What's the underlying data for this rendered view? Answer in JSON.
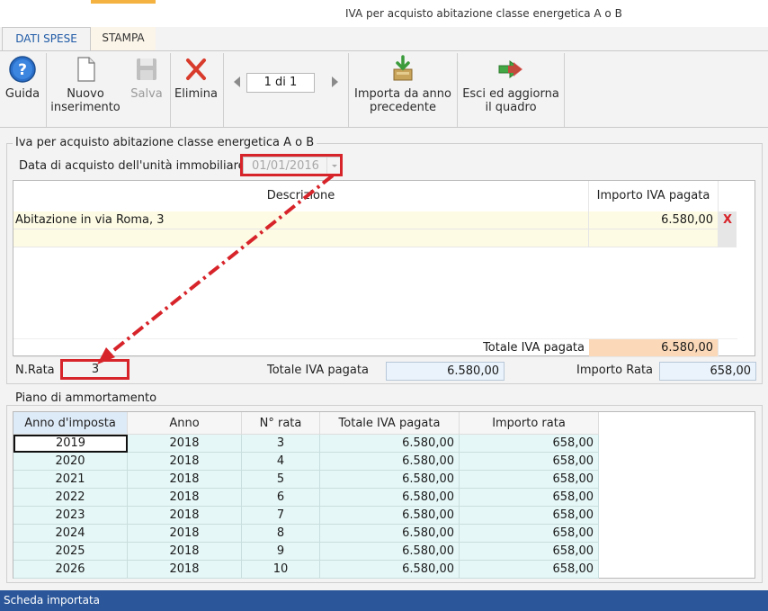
{
  "window": {
    "title": "IVA per acquisto abitazione classe energetica A o B"
  },
  "tabs": [
    {
      "label": "DATI SPESE"
    },
    {
      "label": "STAMPA"
    }
  ],
  "ribbon": {
    "guida": "Guida",
    "nuovo": "Nuovo\ninserimento",
    "salva": "Salva",
    "elimina": "Elimina",
    "pager": "1 di 1",
    "importa": "Importa da anno\nprecedente",
    "esci": "Esci ed aggiorna\nil quadro"
  },
  "section1": {
    "title": "Iva per acquisto abitazione classe energetica A o B",
    "date_label": "Data di acquisto dell'unità immobiliare",
    "date_value": "01/01/2016",
    "col_descrizione": "Descrizione",
    "col_importo": "Importo IVA pagata",
    "rows": [
      {
        "descrizione": "Abitazione in via Roma, 3",
        "importo": "6.580,00",
        "delete": "X"
      },
      {
        "descrizione": "",
        "importo": ""
      }
    ],
    "totale_label": "Totale IVA pagata",
    "totale_value": "6.580,00"
  },
  "summary": {
    "nrata_label": "N.Rata",
    "nrata_value": "3",
    "totale_label": "Totale IVA pagata",
    "totale_value": "6.580,00",
    "importo_rata_label": "Importo Rata",
    "importo_rata_value": "658,00"
  },
  "section2": {
    "title": "Piano di ammortamento",
    "headers": [
      "Anno d'imposta",
      "Anno",
      "N° rata",
      "Totale IVA pagata",
      "Importo rata"
    ],
    "rows": [
      [
        "2019",
        "2018",
        "3",
        "6.580,00",
        "658,00"
      ],
      [
        "2020",
        "2018",
        "4",
        "6.580,00",
        "658,00"
      ],
      [
        "2021",
        "2018",
        "5",
        "6.580,00",
        "658,00"
      ],
      [
        "2022",
        "2018",
        "6",
        "6.580,00",
        "658,00"
      ],
      [
        "2023",
        "2018",
        "7",
        "6.580,00",
        "658,00"
      ],
      [
        "2024",
        "2018",
        "8",
        "6.580,00",
        "658,00"
      ],
      [
        "2025",
        "2018",
        "9",
        "6.580,00",
        "658,00"
      ],
      [
        "2026",
        "2018",
        "10",
        "6.580,00",
        "658,00"
      ]
    ]
  },
  "status": {
    "text": "Scheda importata"
  },
  "colors": {
    "accent_red": "#d7242a",
    "status_blue": "#2b579a",
    "row_yellow": "#fdfbe3",
    "row_cyan": "#e6f7f7",
    "total_orange": "#fbd9b8"
  }
}
